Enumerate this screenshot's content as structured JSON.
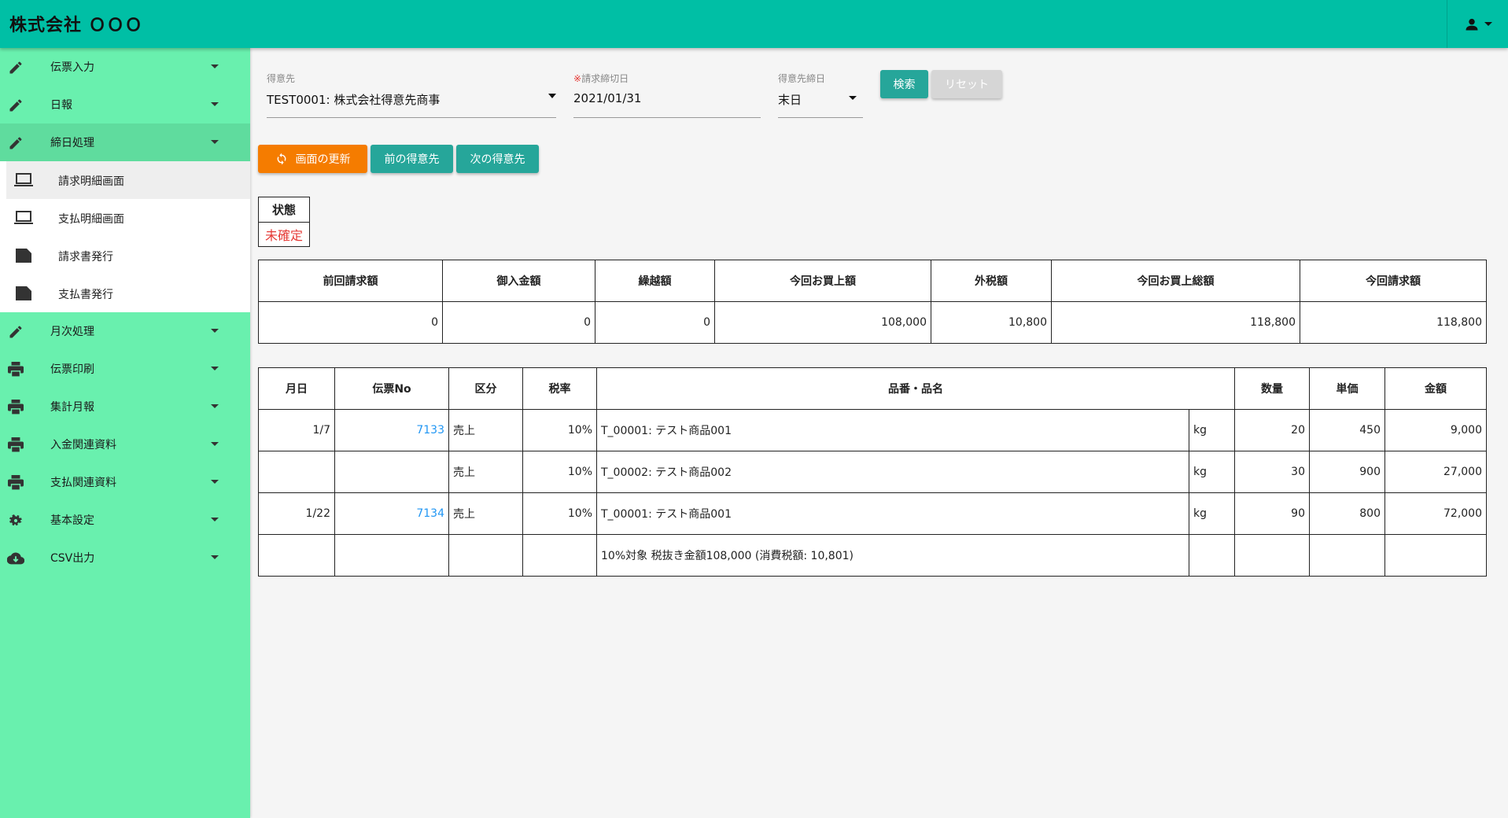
{
  "header": {
    "title": "株式会社 ＯＯＯ"
  },
  "sidebar": {
    "items": [
      {
        "label": "伝票入力",
        "icon": "pencil-icon"
      },
      {
        "label": "日報",
        "icon": "pencil-icon"
      },
      {
        "label": "締日処理",
        "icon": "pencil-icon"
      },
      {
        "label": "月次処理",
        "icon": "pencil-icon"
      },
      {
        "label": "伝票印刷",
        "icon": "printer-icon"
      },
      {
        "label": "集計月報",
        "icon": "printer-icon"
      },
      {
        "label": "入金関連資料",
        "icon": "printer-icon"
      },
      {
        "label": "支払関連資料",
        "icon": "printer-icon"
      },
      {
        "label": "基本設定",
        "icon": "gear-icon"
      },
      {
        "label": "CSV出力",
        "icon": "cloud-download-icon"
      }
    ],
    "subitems": [
      {
        "label": "請求明細画面",
        "icon": "laptop-icon"
      },
      {
        "label": "支払明細画面",
        "icon": "laptop-icon"
      },
      {
        "label": "請求書発行",
        "icon": "label-icon"
      },
      {
        "label": "支払書発行",
        "icon": "label-icon"
      }
    ]
  },
  "filters": {
    "customer_label": "得意先",
    "customer_value": "TEST0001: 株式会社得意先商事",
    "close_date_req": "※",
    "close_date_label": "請求締切日",
    "close_date_value": "2021/01/31",
    "close_day_label": "得意先締日",
    "close_day_value": "末日",
    "search_label": "検索",
    "reset_label": "リセット"
  },
  "actions": {
    "refresh_label": "画面の更新",
    "prev_label": "前の得意先",
    "next_label": "次の得意先"
  },
  "status": {
    "head": "状態",
    "value": "未確定"
  },
  "summary": {
    "headers": [
      "前回請求額",
      "御入金額",
      "繰越額",
      "今回お買上額",
      "外税額",
      "今回お買上総額",
      "今回請求額"
    ],
    "values": [
      "0",
      "0",
      "0",
      "108,000",
      "10,800",
      "118,800",
      "118,800"
    ]
  },
  "detail": {
    "headers": [
      "月日",
      "伝票No",
      "区分",
      "税率",
      "品番・品名",
      "数量",
      "単価",
      "金額"
    ],
    "rows": [
      {
        "date": "1/7",
        "slip": "7133",
        "kind": "売上",
        "tax": "10%",
        "item": "T_00001: テスト商品001",
        "unit": "kg",
        "qty": "20",
        "price": "450",
        "amount": "9,000"
      },
      {
        "date": "",
        "slip": "",
        "kind": "売上",
        "tax": "10%",
        "item": "T_00002: テスト商品002",
        "unit": "kg",
        "qty": "30",
        "price": "900",
        "amount": "27,000"
      },
      {
        "date": "1/22",
        "slip": "7134",
        "kind": "売上",
        "tax": "10%",
        "item": "T_00001: テスト商品001",
        "unit": "kg",
        "qty": "90",
        "price": "800",
        "amount": "72,000"
      }
    ],
    "tax_note": "10%対象 税抜き金額108,000 (消費税額: 10,801)"
  }
}
